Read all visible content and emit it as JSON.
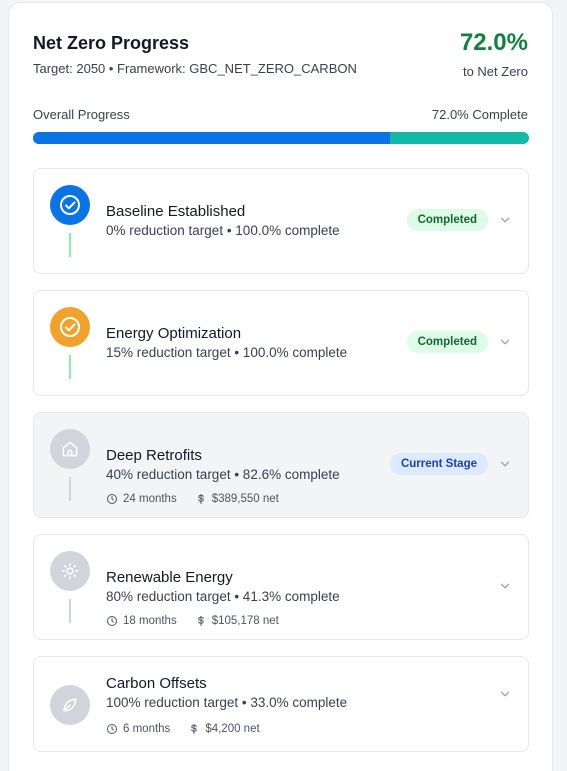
{
  "header": {
    "title": "Net Zero Progress",
    "subtitle": "Target: 2050 • Framework: GBC_NET_ZERO_CARBON",
    "percent": "72.0%",
    "percent_caption": "to Net Zero"
  },
  "overall": {
    "label": "Overall Progress",
    "complete_text": "72.0% Complete",
    "progress_fraction": 0.72
  },
  "colors": {
    "accent_green": "#15803d",
    "bar_blue": "#0b74e5",
    "bar_teal": "#14b8a6",
    "stage_blue": "#0b74e5",
    "stage_orange": "#f0a22d",
    "stage_gray": "#d1d5db",
    "connector_green": "#86efac",
    "connector_gray": "#d1d5db"
  },
  "stages": [
    {
      "name": "Baseline Established",
      "desc": "0% reduction target • 100.0% complete",
      "badge": "Completed",
      "status": "completed",
      "icon": "check-circle-icon"
    },
    {
      "name": "Energy Optimization",
      "desc": "15% reduction target • 100.0% complete",
      "badge": "Completed",
      "status": "completed",
      "icon": "check-circle-icon"
    },
    {
      "name": "Deep Retrofits",
      "desc": "40% reduction target • 82.6% complete",
      "badge": "Current Stage",
      "status": "current",
      "icon": "home-icon",
      "duration": "24 months",
      "cost": "$389,550 net"
    },
    {
      "name": "Renewable Energy",
      "desc": "80% reduction target • 41.3% complete",
      "status": "pending",
      "icon": "sun-icon",
      "duration": "18 months",
      "cost": "$105,178 net"
    },
    {
      "name": "Carbon Offsets",
      "desc": "100% reduction target • 33.0% complete",
      "status": "pending",
      "icon": "leaf-icon",
      "duration": "6 months",
      "cost": "$4,200 net"
    }
  ]
}
